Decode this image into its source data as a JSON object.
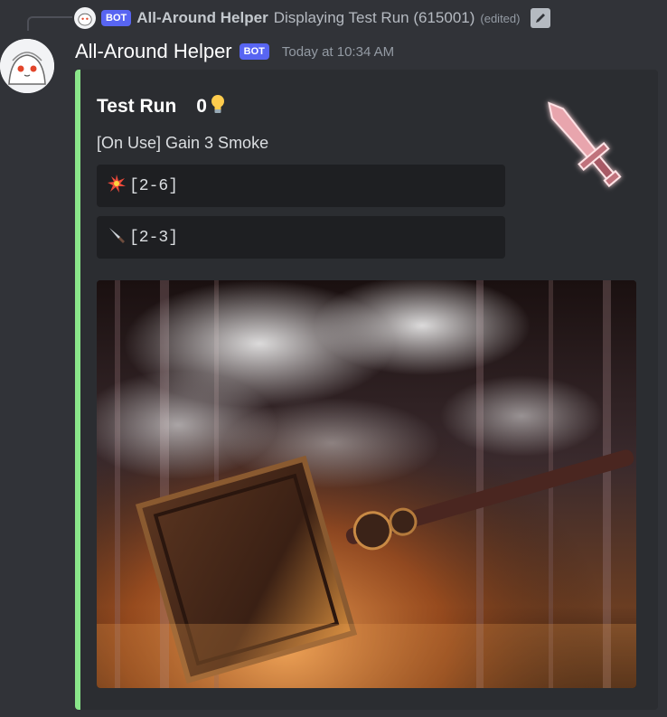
{
  "reply": {
    "bot_tag": "BOT",
    "author": "All-Around Helper",
    "text": "Displaying Test Run (615001)",
    "edited": "(edited)"
  },
  "message": {
    "author": "All-Around Helper",
    "bot_tag": "BOT",
    "timestamp": "Today at 10:34 AM"
  },
  "embed": {
    "accent_color": "#8ae68a",
    "title": "Test Run",
    "cost": "0",
    "cost_icon": "lightbulb-icon",
    "description": "[On Use] Gain 3 Smoke",
    "dice": [
      {
        "icon": "burst-icon",
        "range": "[2-6]"
      },
      {
        "icon": "knife-icon",
        "range": "[2-3]"
      }
    ],
    "thumbnail_icon": "glowing-sword-icon",
    "image": "smoky-hammer-artwork"
  },
  "colors": {
    "background": "#313338",
    "embed_background": "#2b2d31",
    "bot_tag": "#5865f2"
  }
}
